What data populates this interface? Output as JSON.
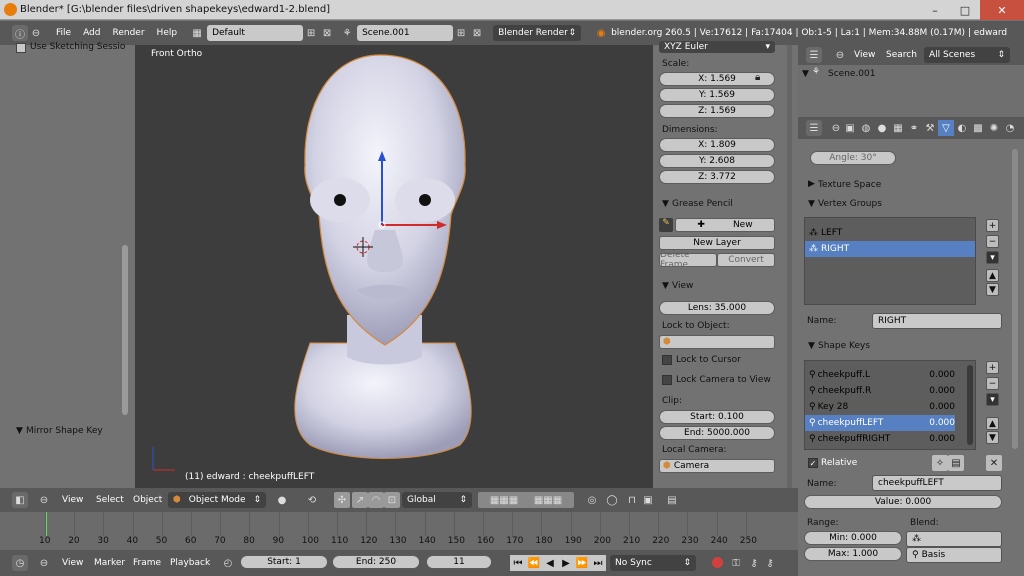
{
  "titlebar": {
    "title": "Blender* [G:\\blender files\\driven shapekeys\\edward1-2.blend]",
    "min": "–",
    "max": "□",
    "close": "✕"
  },
  "header": {
    "menus": [
      "File",
      "Add",
      "Render",
      "Help"
    ],
    "screen_layout": "Default",
    "scene": "Scene.001",
    "render_engine": "Blender Render",
    "stats": "blender.org 260.5 | Ve:17612 | Fa:17404 | Ob:1-5 | La:1 | Mem:34.88M (0.17M) | edward"
  },
  "left_panel": {
    "top_option": "Use Sketching Sessio",
    "mirror_label": "Mirror Shape Key"
  },
  "viewport": {
    "view_label": "Front Ortho",
    "object_label": "(11) edward : cheekpuffLEFT"
  },
  "npanel": {
    "rotation_mode": "XYZ Euler",
    "scale_label": "Scale:",
    "scale": [
      "X: 1.569",
      "Y: 1.569",
      "Z: 1.569"
    ],
    "dimensions_label": "Dimensions:",
    "dimensions": [
      "X: 1.809",
      "Y: 2.608",
      "Z: 3.772"
    ],
    "grease_pencil": "Grease Pencil",
    "new": "New",
    "new_layer": "New Layer",
    "delete_frame": "Delete Frame",
    "convert": "Convert",
    "view": "View",
    "lens": "Lens: 35.000",
    "lock_to_object": "Lock to Object:",
    "lock_to_cursor": "Lock to Cursor",
    "lock_camera": "Lock Camera to View",
    "clip": "Clip:",
    "clip_start": "Start: 0.100",
    "clip_end": "End: 5000.000",
    "local_camera": "Local Camera:",
    "camera": "Camera"
  },
  "outliner": {
    "view": "View",
    "search": "Search",
    "filter": "All Scenes",
    "scene_item": "Scene.001"
  },
  "properties": {
    "angle": "Angle: 30°",
    "texture_space": "Texture Space",
    "vertex_groups": "Vertex Groups",
    "vgroups": [
      "LEFT",
      "RIGHT"
    ],
    "name_label": "Name:",
    "vg_name": "RIGHT",
    "shape_keys": "Shape Keys",
    "keys": [
      {
        "name": "cheekpuff.L",
        "value": "0.000"
      },
      {
        "name": "cheekpuff.R",
        "value": "0.000"
      },
      {
        "name": "Key 28",
        "value": "0.000"
      },
      {
        "name": "cheekpuffLEFT",
        "value": "0.000"
      },
      {
        "name": "cheekpuffRIGHT",
        "value": "0.000"
      }
    ],
    "relative": "Relative",
    "sk_name": "cheekpuffLEFT",
    "value": "Value: 0.000",
    "range": "Range:",
    "blend": "Blend:",
    "min": "Min: 0.000",
    "max": "Max: 1.000",
    "basis": "Basis"
  },
  "view3d_header": {
    "menus": [
      "View",
      "Select",
      "Object"
    ],
    "mode": "Object Mode",
    "orientation": "Global"
  },
  "timeline": {
    "ticks": [
      "10",
      "20",
      "30",
      "40",
      "50",
      "60",
      "70",
      "80",
      "90",
      "100",
      "110",
      "120",
      "130",
      "140",
      "150",
      "160",
      "170",
      "180",
      "190",
      "200",
      "210",
      "220",
      "230",
      "240",
      "250"
    ],
    "current_frame": 11
  },
  "timeline_footer": {
    "menus": [
      "View",
      "Marker",
      "Frame",
      "Playback"
    ],
    "start": "Start: 1",
    "end": "End: 250",
    "frame": "11",
    "sync": "No Sync"
  }
}
